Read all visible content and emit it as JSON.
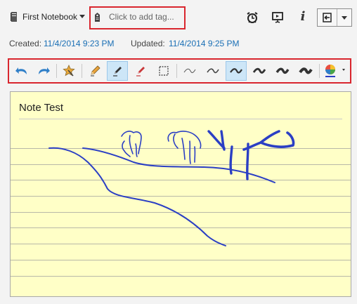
{
  "header": {
    "notebook_name": "First Notebook",
    "tag_placeholder": "Click to add tag..."
  },
  "meta": {
    "created_label": "Created:",
    "created_value": "11/4/2014 9:23 PM",
    "updated_label": "Updated:",
    "updated_value": "11/4/2014 9:25 PM"
  },
  "toolbar": {
    "tools": [
      "undo-icon",
      "redo-icon",
      "highlight-star-icon",
      "pencil-icon",
      "pen-icon",
      "marker-icon",
      "selection-icon",
      "stroke-width-1-icon",
      "stroke-width-2-icon",
      "stroke-width-3-icon",
      "stroke-width-4-icon",
      "stroke-width-5-icon",
      "stroke-width-6-icon",
      "color-picker-icon"
    ],
    "active_tools": [
      "pen-icon",
      "stroke-width-3-icon"
    ]
  },
  "note": {
    "title": "Note Test",
    "ink_color": "#2b3fc4"
  },
  "colors": {
    "accent_red": "#d9262e",
    "link_blue": "#1a6fb5",
    "paper": "#ffffc7"
  }
}
